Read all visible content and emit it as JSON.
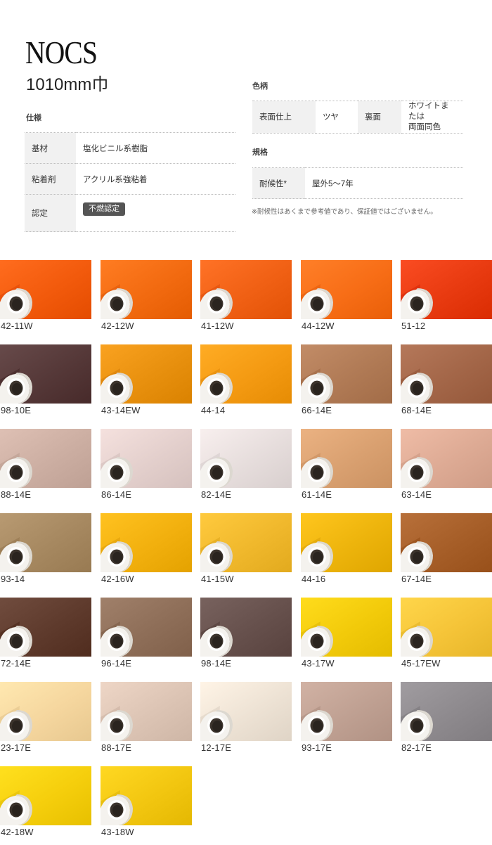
{
  "header": {
    "brand": "NOCS",
    "width_label": "1010mm巾"
  },
  "spec": {
    "title": "仕様",
    "rows": [
      {
        "label": "基材",
        "value": "塩化ビニル系樹脂"
      },
      {
        "label": "粘着剤",
        "value": "アクリル系強粘着"
      },
      {
        "label": "認定",
        "value": "不燃認定"
      }
    ]
  },
  "color_pattern": {
    "title": "色柄",
    "surface_label": "表面仕上",
    "surface_value": "ツヤ",
    "back_label": "裏面",
    "back_value_line1": "ホワイトまたは",
    "back_value_line2": "両面同色"
  },
  "standard": {
    "title": "規格",
    "rows": [
      {
        "label": "耐候性*",
        "value": "屋外5～7年"
      }
    ]
  },
  "note": "※耐候性はあくまで参考値であり、保証値ではございません。",
  "swatches": [
    {
      "code": "42-11W",
      "color": "#F25A0C"
    },
    {
      "code": "42-12W",
      "color": "#F26A10"
    },
    {
      "code": "41-12W",
      "color": "#F06014"
    },
    {
      "code": "44-12W",
      "color": "#F76D16"
    },
    {
      "code": "51-12",
      "color": "#E83A10"
    },
    {
      "code": "98-10E",
      "color": "#553838"
    },
    {
      "code": "43-14EW",
      "color": "#E8900E"
    },
    {
      "code": "44-14",
      "color": "#F49A12"
    },
    {
      "code": "66-14E",
      "color": "#B07A55"
    },
    {
      "code": "68-14E",
      "color": "#A36648"
    },
    {
      "code": "88-14E",
      "color": "#CCAEA2"
    },
    {
      "code": "86-14E",
      "color": "#E3CFCC"
    },
    {
      "code": "82-14E",
      "color": "#E6DDDC"
    },
    {
      "code": "61-14E",
      "color": "#D9A070"
    },
    {
      "code": "63-14E",
      "color": "#DDAA94"
    },
    {
      "code": "93-14",
      "color": "#A68860"
    },
    {
      "code": "42-16W",
      "color": "#F2B00E"
    },
    {
      "code": "41-15W",
      "color": "#F0B82C"
    },
    {
      "code": "44-16",
      "color": "#EDB40C"
    },
    {
      "code": "67-14E",
      "color": "#A65E28"
    },
    {
      "code": "72-14E",
      "color": "#5E3A2C"
    },
    {
      "code": "96-14E",
      "color": "#8E6E58"
    },
    {
      "code": "98-14E",
      "color": "#66504C"
    },
    {
      "code": "43-17W",
      "color": "#F2CA0A"
    },
    {
      "code": "45-17EW",
      "color": "#F5C438"
    },
    {
      "code": "23-17E",
      "color": "#F5D69E"
    },
    {
      "code": "88-17E",
      "color": "#DCC4B4"
    },
    {
      "code": "12-17E",
      "color": "#EDE2D4"
    },
    {
      "code": "93-17E",
      "color": "#BFA092"
    },
    {
      "code": "82-17E",
      "color": "#8E8A8E"
    },
    {
      "code": "42-18W",
      "color": "#F5CE0C"
    },
    {
      "code": "43-18W",
      "color": "#F2C610"
    }
  ]
}
